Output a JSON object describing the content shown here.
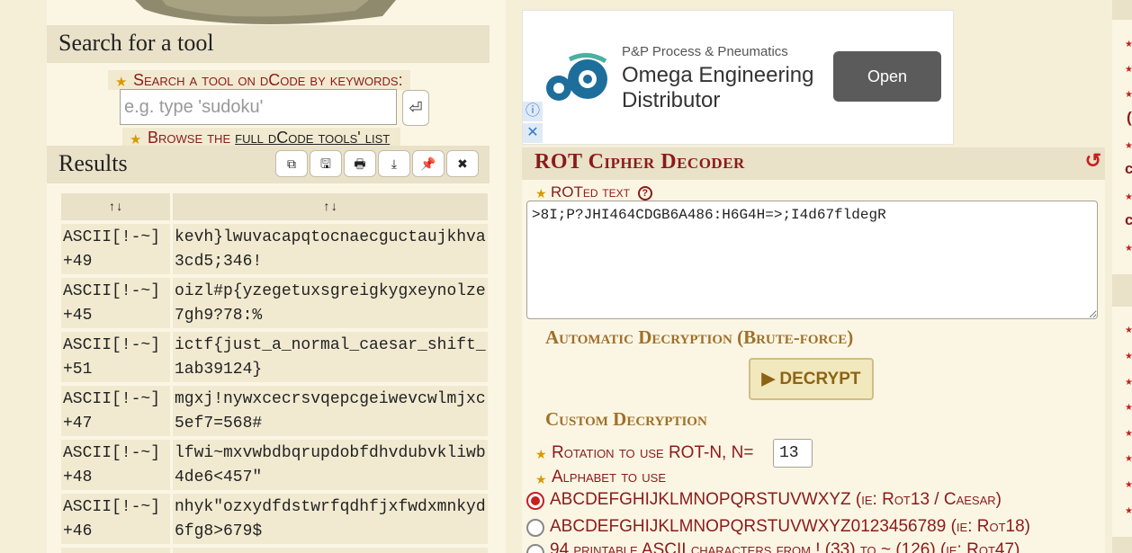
{
  "search": {
    "title": "Search for a tool",
    "keywords_label": "Search a tool on dCode by keywords:",
    "placeholder": "e.g. type 'sudoku'",
    "go_symbol": "⏎",
    "browse_prefix": "Browse the ",
    "browse_link": "full dCode tools' list"
  },
  "results": {
    "title": "Results",
    "toolbar_icons": [
      "copy-icon",
      "save-icon",
      "print-icon",
      "download-icon",
      "pin-icon",
      "close-icon"
    ],
    "toolbar_glyphs": [
      "⧉",
      "🖫",
      "🖶",
      "⤓",
      "📌",
      "✖"
    ],
    "columns": [
      "↑↓",
      "↑↓"
    ],
    "rows": [
      {
        "method": "ASCII[!-~]\n+49",
        "text": "kevh}lwuvacapqtocnaecguctaujkhva\n3cd5;346!"
      },
      {
        "method": "ASCII[!-~]\n+45",
        "text": "oizl#p{yzegetuxsgreigkygxeynolze\n7gh9?78:%"
      },
      {
        "method": "ASCII[!-~]\n+51",
        "text": "ictf{just_a_normal_caesar_shift_\n1ab39124}"
      },
      {
        "method": "ASCII[!-~]\n+47",
        "text": "mgxj!nywxcecrsvqepcgeiwevcwlmjxc\n5ef7=568#"
      },
      {
        "method": "ASCII[!-~]\n+48",
        "text": "lfwi~mxvwbdbqrupdobfdhvdubvkliwb\n4de6<457\""
      },
      {
        "method": "ASCII[!-~]\n+46",
        "text": "nhyk\"ozxydfdstwrfqdhfjxfwdxmnkyd\n6fg8>679$"
      }
    ]
  },
  "ad": {
    "sponsor": "P&P Process & Pneumatics",
    "title": "Omega Engineering Distributor",
    "cta": "Open",
    "info_icon": "ⓘ",
    "close_icon": "✕"
  },
  "rot": {
    "title": "ROT Cipher Decoder",
    "refresh_icon": "↺",
    "text_label": "ROTed text",
    "help": "?",
    "text_value": ">8I;P?JHI464CDGB6A486:H6G4H=>;I4d67fldegR",
    "auto_title": "Automatic Decryption (Brute-force)",
    "decrypt_label": "▶ DECRYPT",
    "custom_title": "Custom Decryption",
    "rotation_label": "Rotation to use ROT-N, N=",
    "rotation_value": "13",
    "alphabet_label": "Alphabet to use",
    "alphabets": [
      {
        "value": "ABCDEFGHIJKLMNOPQRSTUVWXYZ",
        "note": " (ie: Rot13 / Caesar)",
        "selected": true
      },
      {
        "value": "ABCDEFGHIJKLMNOPQRSTUVWXYZ0123456789",
        "note": " (ie: Rot18)",
        "selected": false
      },
      {
        "value": "94 printable ASCII characters from ! (33) to ~ (126)",
        "note": " (ie: Rot47)",
        "selected": false
      }
    ]
  },
  "colors": {
    "accent_red": "#8b1a1a",
    "accent_gold": "#a0702a",
    "panel_bg": "#fbf6e4",
    "header_bg": "#e9e1c8",
    "radio_active": "#c81f1f"
  }
}
